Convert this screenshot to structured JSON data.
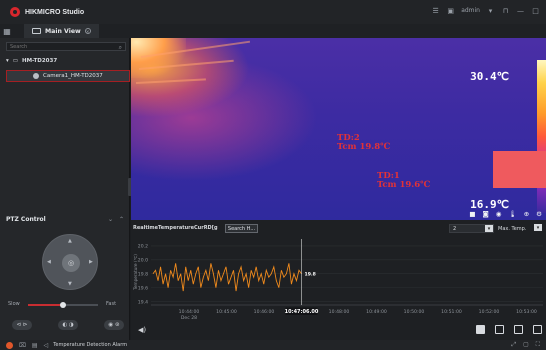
{
  "app": {
    "title": "HIKMICRO Studio",
    "user": "admin"
  },
  "tabs": [
    {
      "label": "Main View"
    }
  ],
  "sidebar": {
    "search_placeholder": "Search",
    "device": "HM-TD2037",
    "camera": "Camera1_HM-TD2037",
    "ptz_title": "PTZ Control",
    "speed_slow": "Slow",
    "speed_fast": "Fast",
    "speed_value": 0.5
  },
  "video": {
    "max_temp": "30.4℃",
    "min_temp": "16.9℃",
    "rois": [
      {
        "id": "TD:2",
        "value": "Tcm 19.8℃"
      },
      {
        "id": "TD:1",
        "value": "Tcm 19.6℃"
      }
    ]
  },
  "chart_panel": {
    "title": "RealtimeTemperatureCurRD[g",
    "search_button": "Search H...",
    "number_select": "2",
    "type_select": "Max. Temp."
  },
  "chart_data": {
    "type": "line",
    "ylabel": "Temperature (℃)",
    "y_ticks": [
      "20.2",
      "20.0",
      "19.8",
      "19.6",
      "19.4"
    ],
    "ylim": [
      19.35,
      20.3
    ],
    "x_ticks": [
      "10:44:00",
      "10:45:00",
      "10:46:00",
      "10:47:06.00",
      "10:48:00",
      "10:49:00",
      "10:50:00",
      "10:51:00",
      "10:52:00",
      "10:53:00"
    ],
    "x_tick_date": "Dec 28",
    "current_label": "19.8",
    "current_tick_index": 3,
    "series": [
      {
        "values": [
          19.8,
          19.85,
          19.7,
          19.9,
          19.65,
          19.8,
          19.6,
          19.85,
          19.75,
          19.95,
          19.7,
          19.8,
          19.55,
          19.9,
          19.7,
          19.85,
          19.65,
          19.8,
          19.9,
          19.6,
          19.75,
          19.85,
          19.7,
          19.95,
          19.8,
          19.6,
          19.85,
          19.7,
          19.8,
          19.9,
          19.65,
          19.75,
          19.85,
          19.55,
          19.8,
          19.9,
          19.7,
          19.8,
          19.6,
          19.85,
          19.75,
          19.9,
          19.7,
          19.8,
          19.65,
          19.85,
          19.75,
          19.8,
          19.9,
          19.7,
          19.6,
          19.85,
          19.75,
          19.8,
          19.95,
          19.65,
          19.8,
          19.7,
          19.85,
          19.8
        ],
        "color": "#f08a1c"
      }
    ]
  },
  "status": {
    "text": "Temperature Detection Alarm"
  },
  "colors": {
    "accent": "#d8272d",
    "series": "#f08a1c",
    "roi": "#e23237"
  }
}
